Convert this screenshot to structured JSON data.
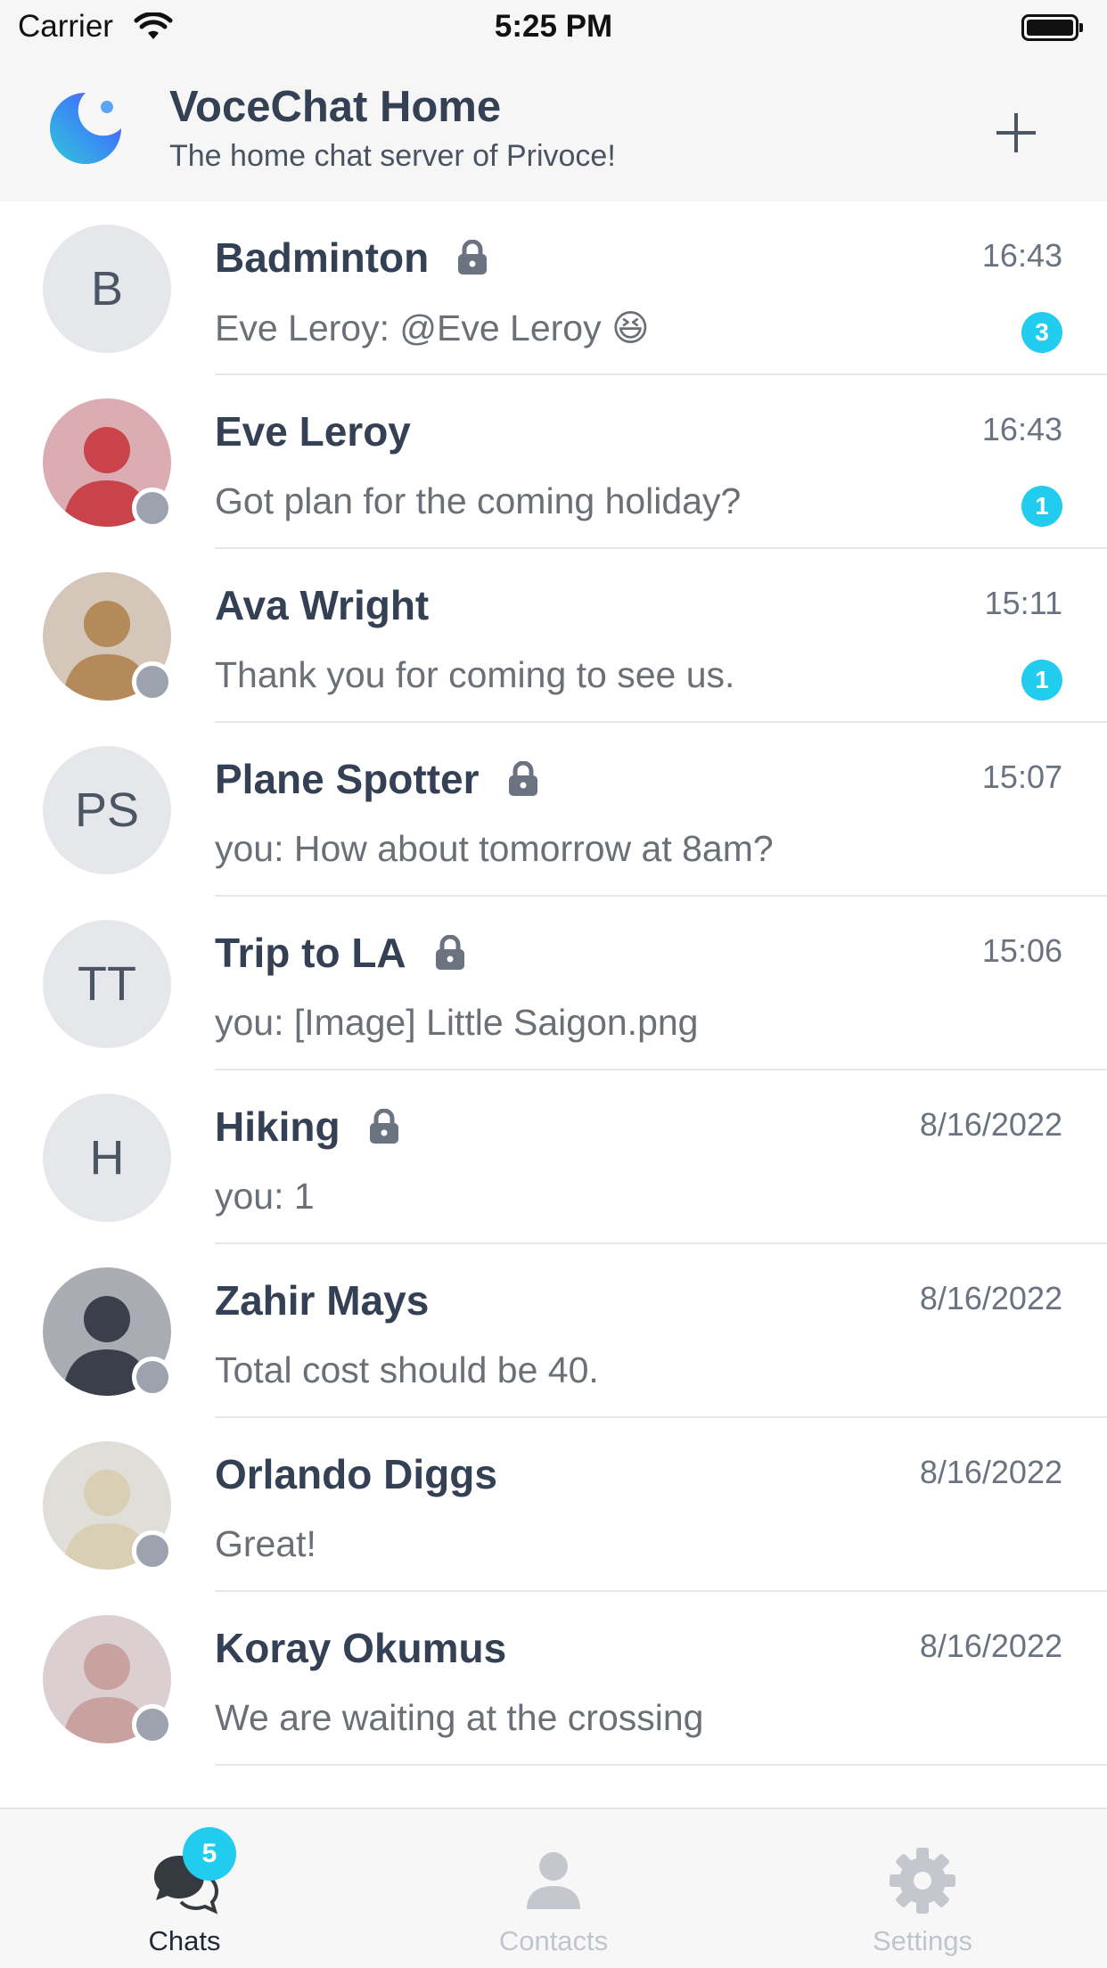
{
  "status_bar": {
    "carrier": "Carrier",
    "time": "5:25 PM"
  },
  "header": {
    "server_name": "VoceChat Home",
    "server_description": "The home chat server of Privoce!",
    "add_icon": "plus-icon"
  },
  "chats": [
    {
      "kind": "channel",
      "initials": "B",
      "name": "Badminton",
      "private": true,
      "time": "16:43",
      "preview": "Eve Leroy:  @Eve Leroy  😆",
      "unread": "3"
    },
    {
      "kind": "user",
      "name": "Eve Leroy",
      "time": "16:43",
      "preview": "Got plan for the coming holiday?",
      "unread": "1",
      "avatar_color": "#c9434b"
    },
    {
      "kind": "user",
      "name": "Ava Wright",
      "time": "15:11",
      "preview": "Thank you for coming to see us.",
      "unread": "1",
      "avatar_color": "#b58a5a"
    },
    {
      "kind": "channel",
      "initials": "PS",
      "name": "Plane Spotter",
      "private": true,
      "time": "15:07",
      "preview": "you: How about tomorrow at 8am?"
    },
    {
      "kind": "channel",
      "initials": "TT",
      "name": "Trip to LA",
      "private": true,
      "time": "15:06",
      "preview": "you: [Image] Little Saigon.png"
    },
    {
      "kind": "channel",
      "initials": "H",
      "name": "Hiking",
      "private": true,
      "time": "8/16/2022",
      "preview": "you: 1"
    },
    {
      "kind": "user",
      "name": "Zahir Mays",
      "time": "8/16/2022",
      "preview": "Total cost should be 40.",
      "avatar_color": "#3a3f4a"
    },
    {
      "kind": "user",
      "name": "Orlando Diggs",
      "time": "8/16/2022",
      "preview": "Great!",
      "avatar_color": "#d8cfb4"
    },
    {
      "kind": "user",
      "name": "Koray Okumus",
      "time": "8/16/2022",
      "preview": "We are waiting at the crossing",
      "avatar_color": "#c9a2a0"
    }
  ],
  "tabs": [
    {
      "label": "Chats",
      "icon": "chat-bubbles-icon",
      "active": true,
      "badge": "5"
    },
    {
      "label": "Contacts",
      "icon": "person-icon",
      "active": false
    },
    {
      "label": "Settings",
      "icon": "gear-icon",
      "active": false
    }
  ],
  "colors": {
    "accent": "#22ccee",
    "title": "#344054",
    "muted": "#6b7280"
  }
}
